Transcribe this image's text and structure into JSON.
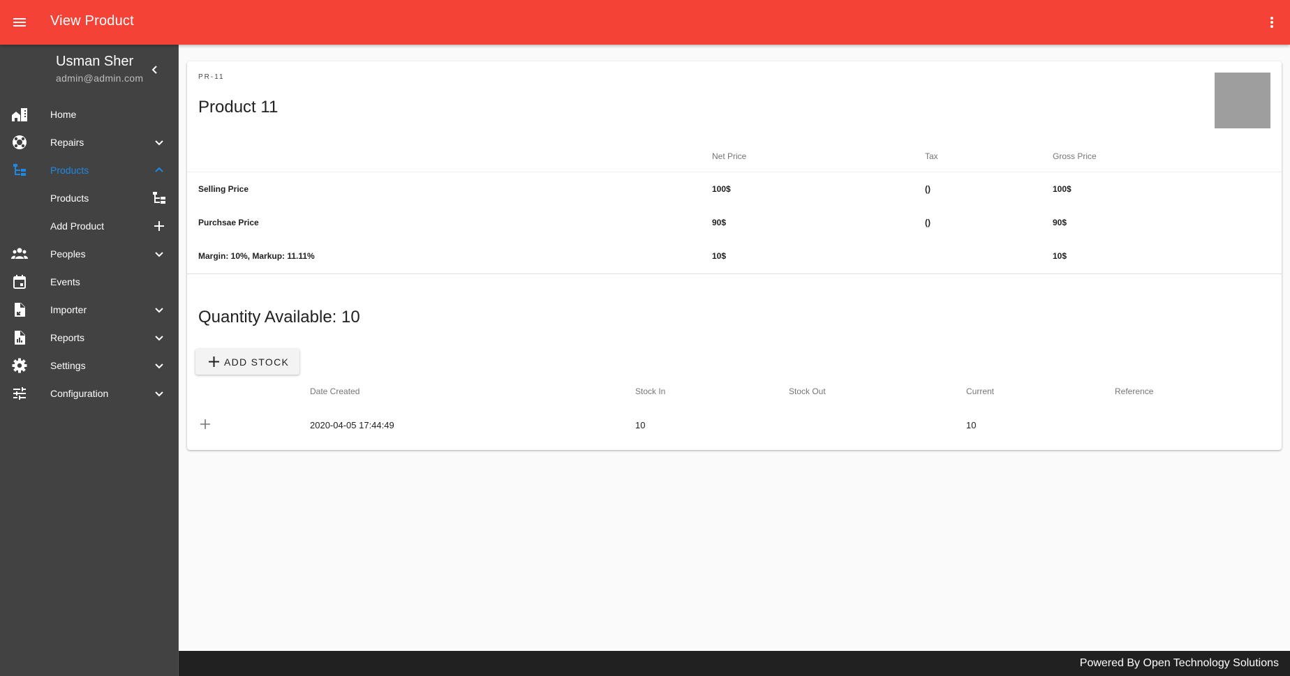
{
  "appbar": {
    "title": "View Product",
    "menu_icon": "hamburger-menu-icon",
    "more_icon": "more-vertical-icon",
    "color": "#f44336"
  },
  "sidebar": {
    "user": {
      "name": "Usman Sher",
      "email": "admin@admin.com"
    },
    "collapse_icon": "chevron-left-icon",
    "items": [
      {
        "label": "Home",
        "icon": "home-city-icon",
        "expandable": false
      },
      {
        "label": "Repairs",
        "icon": "lifebuoy-icon",
        "expandable": true,
        "expanded": false
      },
      {
        "label": "Products",
        "icon": "file-tree-icon",
        "expandable": true,
        "expanded": true,
        "active": true,
        "children": [
          {
            "label": "Products",
            "icon": "file-tree-icon"
          },
          {
            "label": "Add Product",
            "icon": "plus-icon"
          }
        ]
      },
      {
        "label": "Peoples",
        "icon": "account-group-icon",
        "expandable": true,
        "expanded": false
      },
      {
        "label": "Events",
        "icon": "calendar-icon",
        "expandable": false
      },
      {
        "label": "Importer",
        "icon": "file-import-icon",
        "expandable": true,
        "expanded": false
      },
      {
        "label": "Reports",
        "icon": "file-chart-icon",
        "expandable": true,
        "expanded": false
      },
      {
        "label": "Settings",
        "icon": "gear-icon",
        "expandable": true,
        "expanded": false
      },
      {
        "label": "Configuration",
        "icon": "tune-icon",
        "expandable": true,
        "expanded": false
      }
    ],
    "active_color": "#1e88e5"
  },
  "product": {
    "code": "PR-11",
    "name": "Product 11",
    "image_placeholder_color": "#9e9e9e",
    "price_table": {
      "headers": [
        "",
        "Net Price",
        "Tax",
        "Gross Price"
      ],
      "rows": [
        {
          "label": "Selling Price",
          "net": "100$",
          "tax": "()",
          "gross": "100$"
        },
        {
          "label": "Purchsae Price",
          "net": "90$",
          "tax": "()",
          "gross": "90$"
        },
        {
          "label": "Margin: 10%, Markup: 11.11%",
          "net": "10$",
          "tax": "",
          "gross": "10$"
        }
      ]
    },
    "quantity_title": "Quantity Available: 10",
    "add_stock_label": "ADD STOCK",
    "stock_table": {
      "headers": [
        "",
        "Date Created",
        "Stock In",
        "Stock Out",
        "Current",
        "Reference"
      ],
      "rows": [
        {
          "date_created": "2020-04-05 17:44:49",
          "stock_in": "10",
          "stock_out": "",
          "current": "10",
          "reference": ""
        }
      ]
    }
  },
  "footer": {
    "text": "Powered By Open Technology Solutions"
  }
}
